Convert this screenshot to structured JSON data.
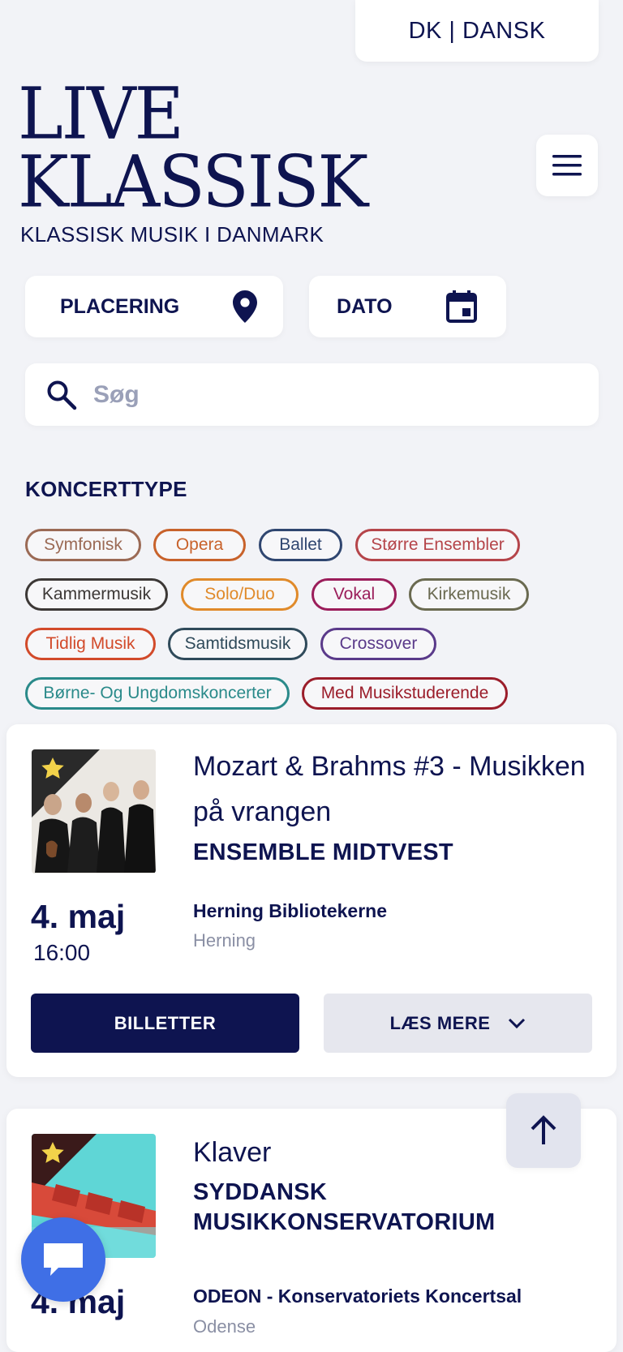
{
  "language": {
    "label": "DK | DANSK"
  },
  "logo": {
    "line1": "LIVE",
    "line2": "KLASSISK",
    "tagline": "KLASSISK MUSIK I DANMARK"
  },
  "filters": {
    "location_label": "PLACERING",
    "date_label": "DATO"
  },
  "search": {
    "placeholder": "Søg"
  },
  "concert_types": {
    "title": "KONCERTTYPE",
    "chips": [
      {
        "label": "Symfonisk",
        "color": "#9b6a55"
      },
      {
        "label": "Opera",
        "color": "#c8622b"
      },
      {
        "label": "Ballet",
        "color": "#2f4670"
      },
      {
        "label": "Større Ensembler",
        "color": "#b5454a"
      },
      {
        "label": "Kammermusik",
        "color": "#3c3836"
      },
      {
        "label": "Solo/Duo",
        "color": "#e08a2a"
      },
      {
        "label": "Vokal",
        "color": "#9b1d5a"
      },
      {
        "label": "Kirkemusik",
        "color": "#6a6a50"
      },
      {
        "label": "Tidlig Musik",
        "color": "#d24a2a"
      },
      {
        "label": "Samtidsmusik",
        "color": "#2f4a5a"
      },
      {
        "label": "Crossover",
        "color": "#5a3a8a"
      },
      {
        "label": "Børne- Og Ungdomskoncerter",
        "color": "#2a8a8a"
      },
      {
        "label": "Med Musikstuderende",
        "color": "#9b1d2a"
      }
    ]
  },
  "events": [
    {
      "title": "Mozart & Brahms #3 - Musikken på vrangen",
      "organizer": "ENSEMBLE MIDTVEST",
      "date": "4. maj",
      "time": "16:00",
      "venue": "Herning Bibliotekerne",
      "city": "Herning",
      "tickets_label": "BILLETTER",
      "more_label": "LÆS MERE"
    },
    {
      "title": "Klaver",
      "organizer_line1": "SYDDANSK",
      "organizer_line2": "MUSIKKONSERVATORIUM",
      "date": "4. maj",
      "venue": "ODEON - Konservatoriets Koncertsal",
      "city": "Odense"
    }
  ],
  "colors": {
    "brand": "#0e1450",
    "chat": "#3f6fe6",
    "star": "#f2d24a"
  },
  "icons": [
    "menu-icon",
    "location-pin-icon",
    "calendar-icon",
    "search-icon",
    "star-icon",
    "chevron-down-icon",
    "arrow-up-icon",
    "chat-icon"
  ]
}
